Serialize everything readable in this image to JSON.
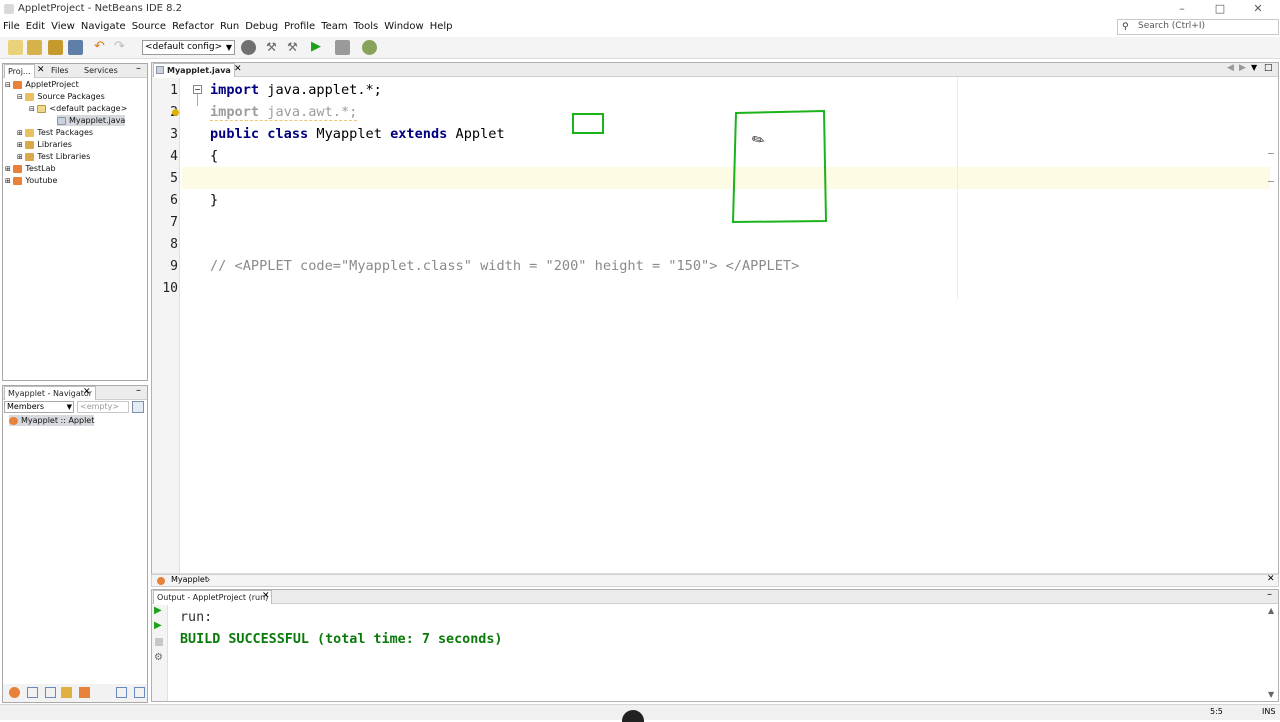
{
  "window": {
    "title": "AppletProject - NetBeans IDE 8.2"
  },
  "menu": [
    "File",
    "Edit",
    "View",
    "Navigate",
    "Source",
    "Refactor",
    "Run",
    "Debug",
    "Profile",
    "Team",
    "Tools",
    "Window",
    "Help"
  ],
  "search": {
    "placeholder": "Search (Ctrl+I)"
  },
  "toolbar": {
    "config": "<default config>"
  },
  "projects": {
    "tabs": [
      "Proj...",
      "Files",
      "Services"
    ],
    "tree": {
      "applet_project": "AppletProject",
      "source_packages": "Source Packages",
      "default_package": "<default package>",
      "myapplet_java": "Myapplet.java",
      "test_packages": "Test Packages",
      "libraries": "Libraries",
      "test_libraries": "Test Libraries",
      "testlab": "TestLab",
      "youtube": "Youtube"
    }
  },
  "navigator": {
    "tab": "Myapplet - Navigator",
    "filter": "Members",
    "empty": "<empty>",
    "item": "Myapplet :: Applet"
  },
  "editor": {
    "tab": "Myapplet.java",
    "line_numbers": [
      "1",
      "2",
      "3",
      "4",
      "5",
      "6",
      "7",
      "8",
      "9",
      "10"
    ],
    "breadcrumb": "Myapplet",
    "code": {
      "l1_kw": "import",
      "l1_rest": " java.applet.*;",
      "l2_kw": "import",
      "l2_rest": " java.awt.*;",
      "l3_kw1": "public class",
      "l3_mid": " Myapplet ",
      "l3_kw2": "extends",
      "l3_rest": " Applet",
      "l4": "{",
      "l6": "}",
      "l9": "// <APPLET code=\"Myapplet.class\" width = \"200\" height = \"150\"> </APPLET>"
    }
  },
  "output": {
    "tab": "Output - AppletProject (run)",
    "line1": "run:",
    "line2": "BUILD SUCCESSFUL (total time: 7 seconds)"
  },
  "status": {
    "position": "5:5",
    "mode": "INS"
  },
  "colors": {
    "keyword": "#000080",
    "success": "#0a7a0a",
    "annotation": "#1ab31a"
  }
}
